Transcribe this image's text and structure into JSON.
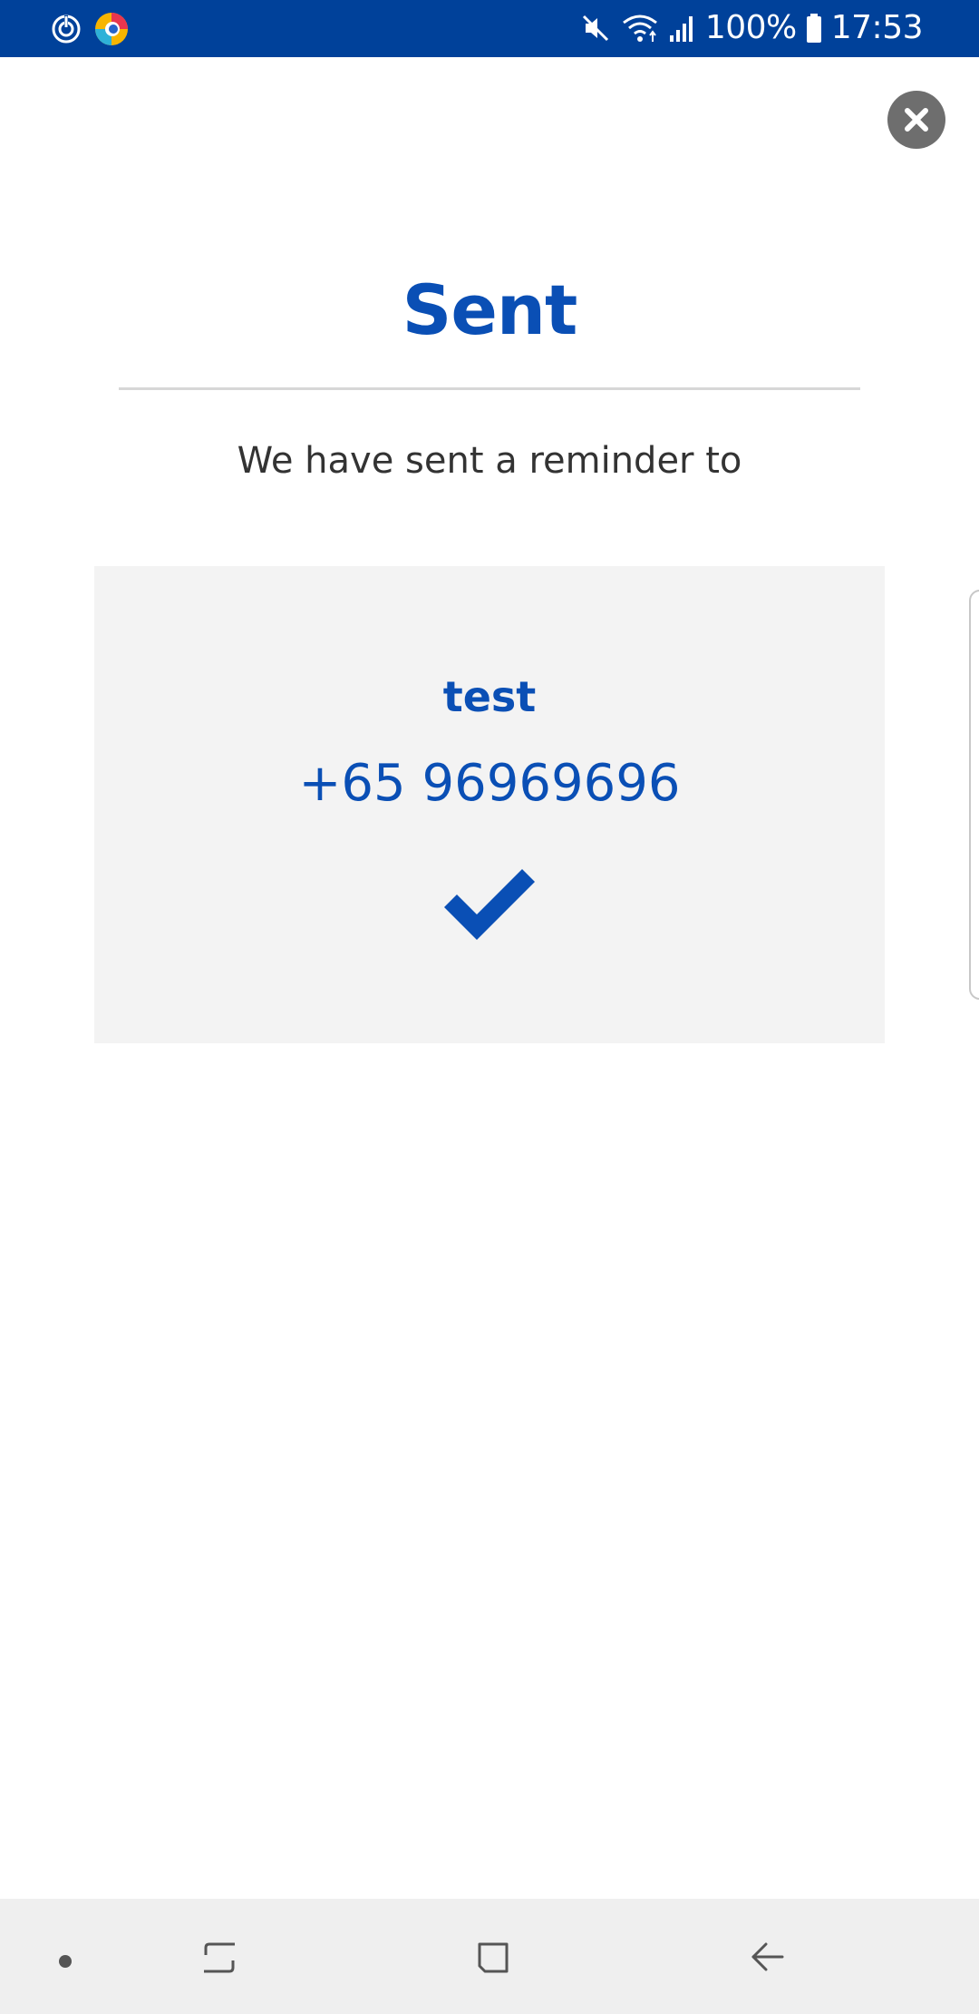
{
  "status_bar": {
    "battery_text": "100%",
    "time": "17:53",
    "left_icons": [
      "sync-icon",
      "browser-app-icon"
    ],
    "right_icons": [
      "mute-icon",
      "wifi-icon",
      "signal-icon",
      "battery-icon"
    ],
    "background_color": "#00419a"
  },
  "dialog": {
    "title": "Sent",
    "message": "We have sent a reminder to",
    "close_icon": "close-icon"
  },
  "recipient_card": {
    "name": "test",
    "phone": "+65 96969696",
    "status_icon": "checkmark-icon",
    "accent_color": "#0a4fb5"
  },
  "nav_bar": {
    "buttons": [
      "dot-indicator",
      "recent-apps-icon",
      "home-icon",
      "back-icon"
    ]
  }
}
